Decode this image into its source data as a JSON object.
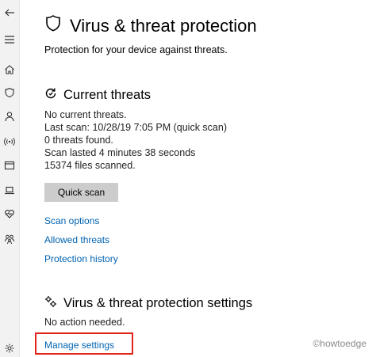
{
  "nav": {
    "icons": [
      "back-arrow-icon",
      "hamburger-menu-icon",
      "home-icon",
      "shield-icon",
      "person-icon",
      "wireless-icon",
      "app-browser-icon",
      "laptop-icon",
      "heart-icon",
      "family-icon",
      "gear-icon"
    ]
  },
  "page": {
    "title": "Virus & threat protection",
    "subtitle": "Protection for your device against threats."
  },
  "current_threats": {
    "title": "Current threats",
    "lines": [
      "No current threats.",
      "Last scan: 10/28/19 7:05 PM (quick scan)",
      "0 threats found.",
      "Scan lasted 4 minutes 38 seconds",
      "15374 files scanned."
    ],
    "quick_scan_label": "Quick scan",
    "links": [
      "Scan options",
      "Allowed threats",
      "Protection history"
    ]
  },
  "settings": {
    "title": "Virus & threat protection settings",
    "status": "No action needed.",
    "manage_link": "Manage settings"
  },
  "watermark": "©howtoedge",
  "colors": {
    "link": "#0063b1",
    "highlight": "#e0241a",
    "button": "#cccccc"
  }
}
